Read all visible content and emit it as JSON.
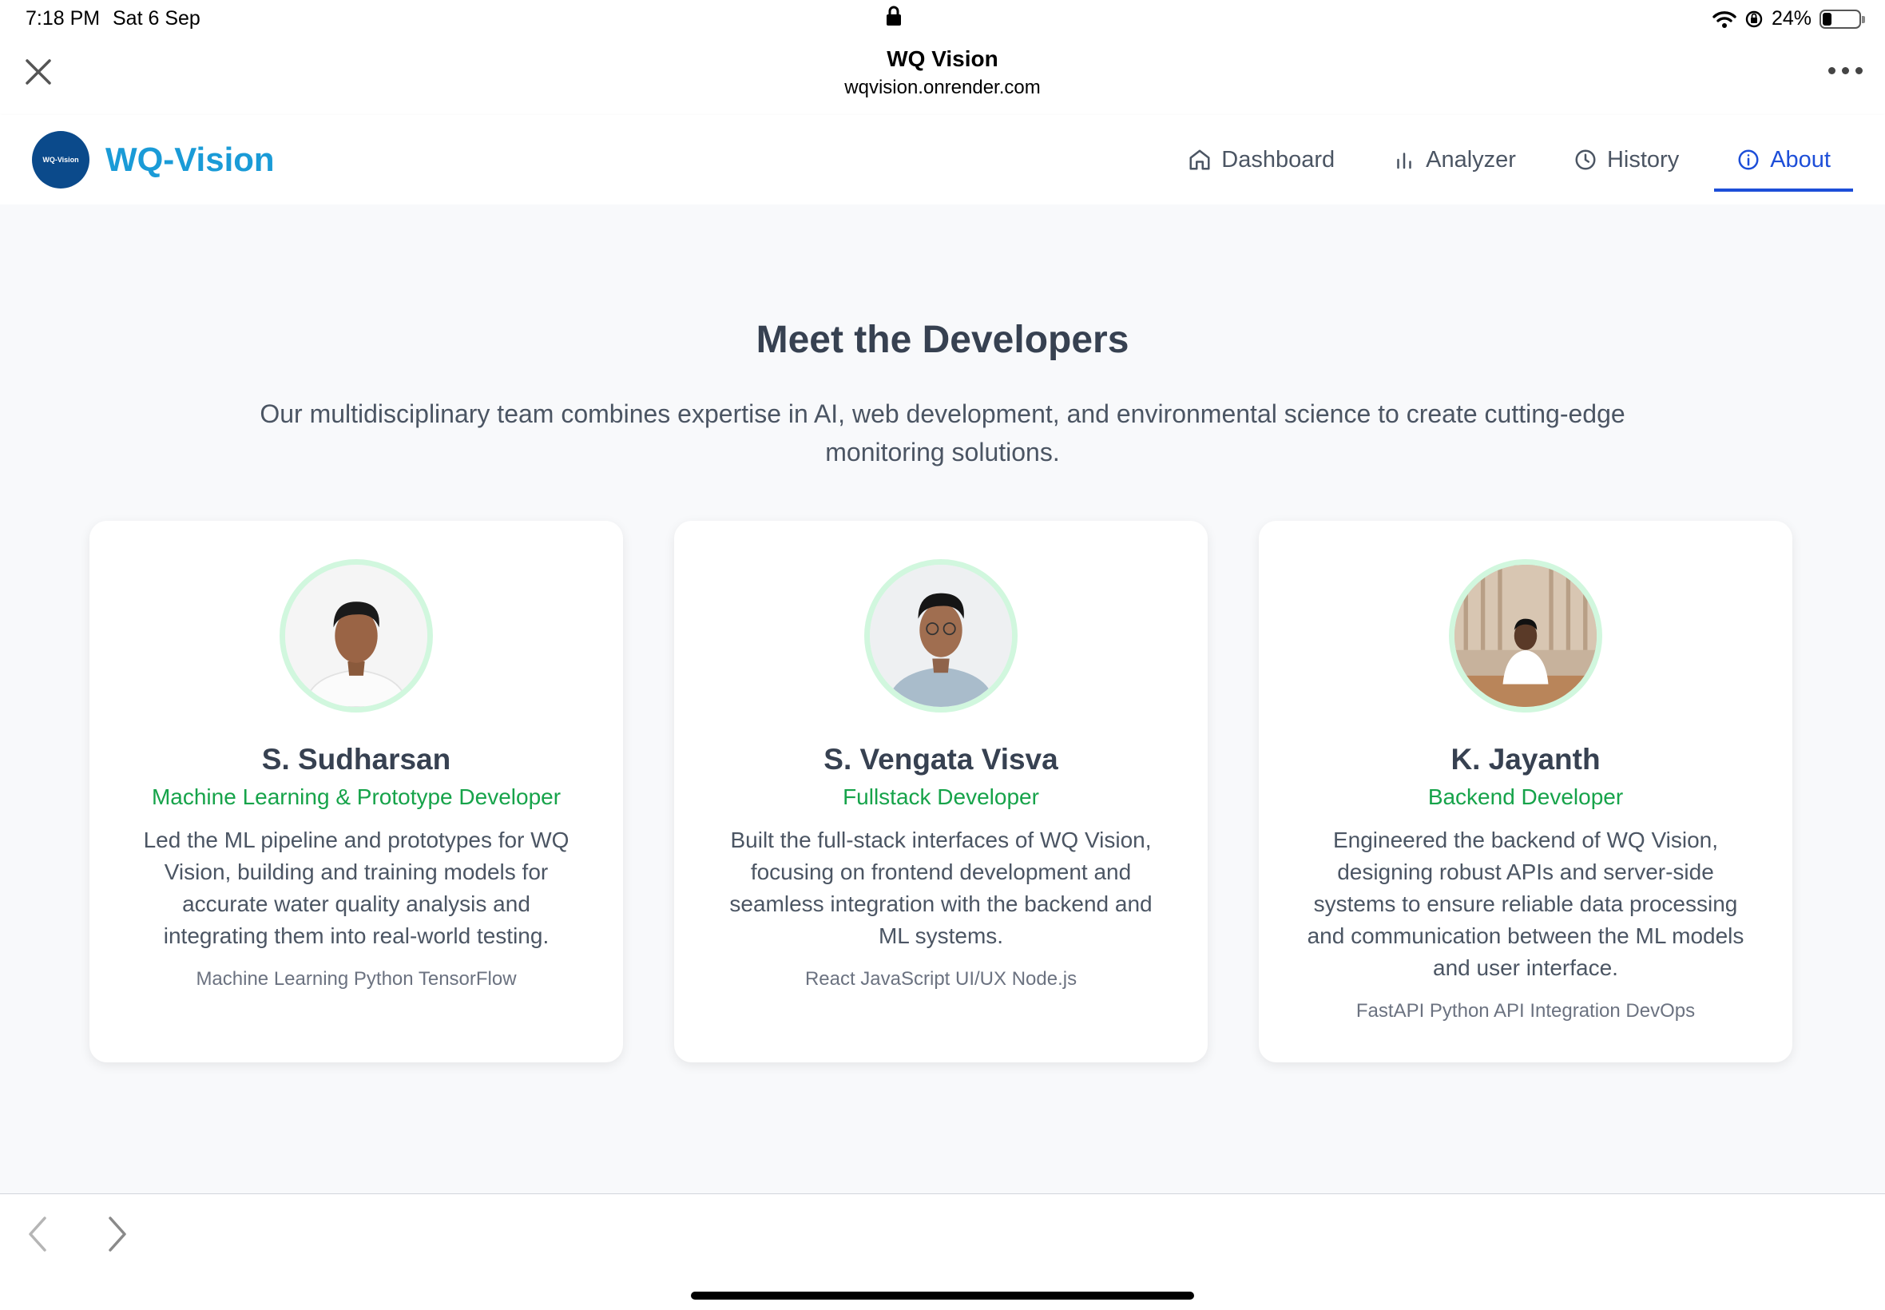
{
  "status_bar": {
    "time": "7:18 PM",
    "date": "Sat 6 Sep",
    "battery": "24%",
    "battery_level": 0.24
  },
  "browser": {
    "title": "WQ Vision",
    "url": "wqvision.onrender.com"
  },
  "app": {
    "brand": "WQ-Vision",
    "logo_text": "WQ-Vision",
    "brand_color": "#1a9bd7",
    "accent_color": "#1d4ed8",
    "nav": [
      {
        "label": "Dashboard",
        "icon": "home-icon"
      },
      {
        "label": "Analyzer",
        "icon": "bar-chart-icon"
      },
      {
        "label": "History",
        "icon": "clock-icon"
      },
      {
        "label": "About",
        "icon": "info-icon",
        "active": true
      }
    ]
  },
  "main": {
    "title": "Meet the Developers",
    "subtitle": "Our multidisciplinary team combines expertise in AI, web development, and environmental science to create cutting-edge monitoring solutions.",
    "role_color": "#16a34a",
    "developers": [
      {
        "name": "S. Sudharsan",
        "role": "Machine Learning & Prototype Developer",
        "description": "Led the ML pipeline and prototypes for WQ Vision, building and training models for accurate water quality analysis and integrating them into real-world testing.",
        "skills": "Machine Learning Python TensorFlow"
      },
      {
        "name": "S. Vengata Visva",
        "role": "Fullstack Developer",
        "description": "Built the full-stack interfaces of WQ Vision, focusing on frontend development and seamless integration with the backend and ML systems.",
        "skills": "React JavaScript UI/UX Node.js"
      },
      {
        "name": "K. Jayanth",
        "role": "Backend Developer",
        "description": "Engineered the backend of WQ Vision, designing robust APIs and server-side systems to ensure reliable data processing and communication between the ML models and user interface.",
        "skills": "FastAPI Python API Integration DevOps"
      }
    ]
  }
}
